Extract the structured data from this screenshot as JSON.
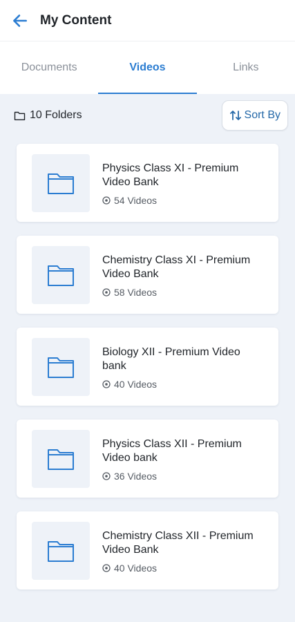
{
  "header": {
    "title": "My Content",
    "back_icon": "arrow-left-icon"
  },
  "tabs": [
    {
      "label": "Documents",
      "active": false
    },
    {
      "label": "Videos",
      "active": true
    },
    {
      "label": "Links",
      "active": false
    }
  ],
  "toolbar": {
    "folder_count": "10 Folders",
    "sort_label": "Sort By"
  },
  "colors": {
    "accent": "#2a7cd1",
    "background": "#eef2f8"
  },
  "folders": [
    {
      "title": "Physics Class XI - Premium Video Bank",
      "count": "54 Videos"
    },
    {
      "title": "Chemistry Class XI - Premium Video Bank",
      "count": "58 Videos"
    },
    {
      "title": "Biology XII - Premium Video bank",
      "count": "40 Videos"
    },
    {
      "title": "Physics Class XII - Premium Video bank",
      "count": "36 Videos"
    },
    {
      "title": "Chemistry Class XII - Premium Video Bank",
      "count": "40 Videos"
    }
  ]
}
